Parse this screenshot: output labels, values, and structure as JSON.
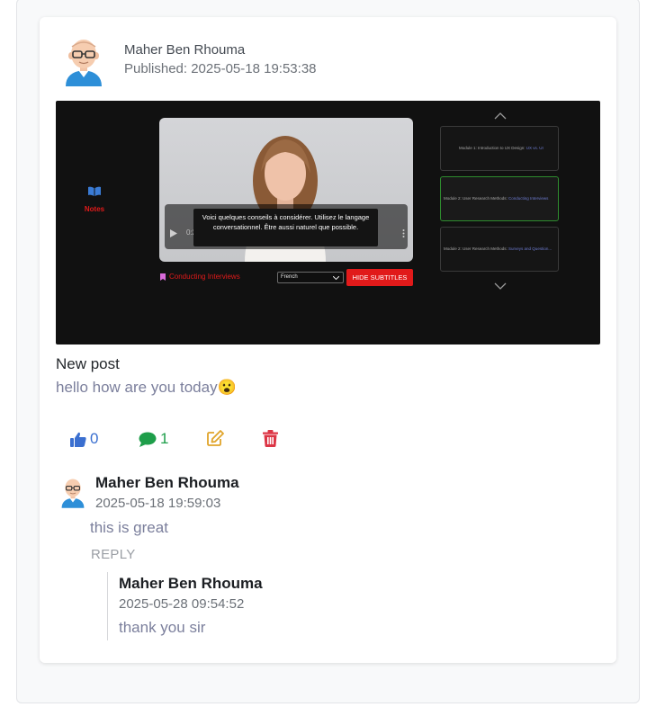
{
  "post": {
    "author": "Maher Ben Rhouma",
    "published": "Published: 2025-05-18 19:53:38",
    "title": "New post",
    "body": "hello how are you today😮",
    "likes": "0",
    "comments_count": "1"
  },
  "media": {
    "notes_label": "Notes",
    "subtitle_text": "Voici quelques conseils à considérer. Utilisez le langage conversationnel. Être aussi naturel que possible.",
    "time_label": "0:2",
    "lesson_label": "Conducting Interviews",
    "language_option": "French",
    "hide_subtitles_label": "HIDE SUBTITLES",
    "modules": [
      {
        "label": "Module 1: Introduction to UX Design: ",
        "highlight": "UX vs. UI"
      },
      {
        "label": "Module 2: User Research Methods: ",
        "highlight": "Conducting Interviews"
      },
      {
        "label": "Module 2: User Research Methods: ",
        "highlight": "Surveys and Question..."
      }
    ]
  },
  "comments": [
    {
      "author": "Maher Ben Rhouma",
      "date": "2025-05-18 19:59:03",
      "text": "this is great",
      "reply_label": "REPLY",
      "replies": [
        {
          "author": "Maher Ben Rhouma",
          "date": "2025-05-28 09:54:52",
          "text": "thank you sir"
        }
      ]
    }
  ],
  "colors": {
    "like": "#3a6fd0",
    "comment": "#1e9e4a",
    "edit": "#e0a42a",
    "delete": "#dc3545",
    "accent_red": "#e11a1a"
  }
}
